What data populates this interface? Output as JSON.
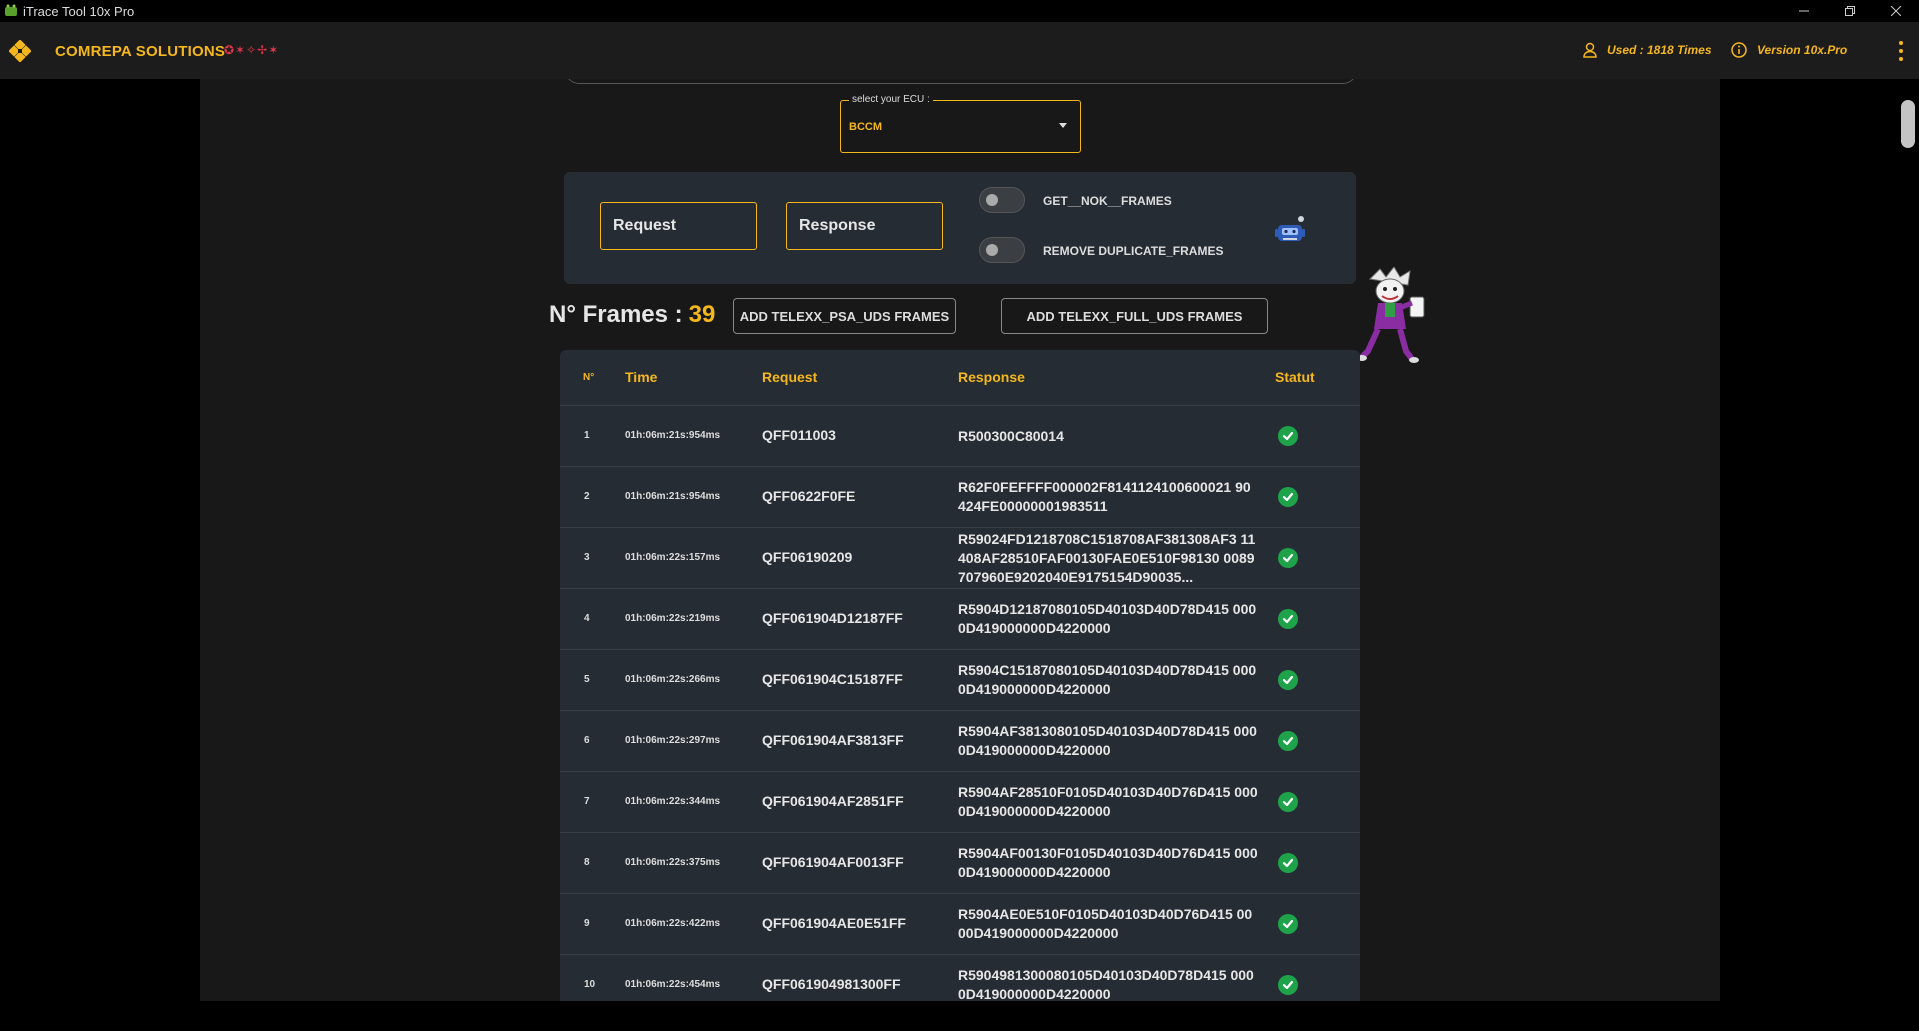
{
  "window": {
    "title": "iTrace Tool 10x Pro"
  },
  "header": {
    "brand": "COMREPA SOLUTIONS",
    "brand_deco": "✪✶✧✢✶",
    "used": "Used : 1818 Times",
    "version": "Version 10x.Pro"
  },
  "ecu": {
    "label": "select your ECU :",
    "value": "BCCM"
  },
  "filters": {
    "request_label": "Request",
    "response_label": "Response",
    "toggle1_label": "GET__NOK__FRAMES",
    "toggle2_label": "REMOVE DUPLICATE_FRAMES",
    "toggle1_on": false,
    "toggle2_on": false
  },
  "frames": {
    "title": "N° Frames :",
    "count": "39",
    "btn_psa": "ADD TELEXX_PSA_UDS FRAMES",
    "btn_full": "ADD TELEXX_FULL_UDS FRAMES"
  },
  "table": {
    "headers": {
      "n": "N°",
      "time": "Time",
      "request": "Request",
      "response": "Response",
      "statut": "Statut"
    },
    "rows": [
      {
        "n": "1",
        "time": "01h:06m:21s:954ms",
        "request": "QFF011003",
        "response": "R500300C80014",
        "statut": "ok"
      },
      {
        "n": "2",
        "time": "01h:06m:21s:954ms",
        "request": "QFF0622F0FE",
        "response": "R62F0FEFFFF000002F8141124100600021 90424FE00000001983511",
        "statut": "ok"
      },
      {
        "n": "3",
        "time": "01h:06m:22s:157ms",
        "request": "QFF06190209",
        "response": "R59024FD1218708C1518708AF381308AF3 11408AF28510FAF00130FAE0E510F98130 0089707960E9202040E9175154D90035...",
        "statut": "ok"
      },
      {
        "n": "4",
        "time": "01h:06m:22s:219ms",
        "request": "QFF061904D12187FF",
        "response": "R5904D12187080105D40103D40D78D415 0000D419000000D4220000",
        "statut": "ok"
      },
      {
        "n": "5",
        "time": "01h:06m:22s:266ms",
        "request": "QFF061904C15187FF",
        "response": "R5904C15187080105D40103D40D78D415 0000D419000000D4220000",
        "statut": "ok"
      },
      {
        "n": "6",
        "time": "01h:06m:22s:297ms",
        "request": "QFF061904AF3813FF",
        "response": "R5904AF3813080105D40103D40D78D415 0000D419000000D4220000",
        "statut": "ok"
      },
      {
        "n": "7",
        "time": "01h:06m:22s:344ms",
        "request": "QFF061904AF2851FF",
        "response": "R5904AF28510F0105D40103D40D76D415 0000D419000000D4220000",
        "statut": "ok"
      },
      {
        "n": "8",
        "time": "01h:06m:22s:375ms",
        "request": "QFF061904AF0013FF",
        "response": "R5904AF00130F0105D40103D40D76D415 0000D419000000D4220000",
        "statut": "ok"
      },
      {
        "n": "9",
        "time": "01h:06m:22s:422ms",
        "request": "QFF061904AE0E51FF",
        "response": "R5904AE0E510F0105D40103D40D76D415 0000D419000000D4220000",
        "statut": "ok"
      },
      {
        "n": "10",
        "time": "01h:06m:22s:454ms",
        "request": "QFF061904981300FF",
        "response": "R5904981300080105D40103D40D78D415 0000D419000000D4220000",
        "statut": "ok"
      }
    ]
  },
  "icons": {
    "app": "app-logo-icon",
    "logo": "diamond-logo-icon",
    "user": "user-icon",
    "info": "info-icon",
    "menu": "kebab-menu-icon",
    "status": "check-circle-icon",
    "robot": "robot-icon",
    "mascot": "joker-mascot"
  },
  "colors": {
    "accent": "#f5b71c",
    "success": "#1fa34a",
    "card": "#262c33",
    "background": "#181818"
  }
}
